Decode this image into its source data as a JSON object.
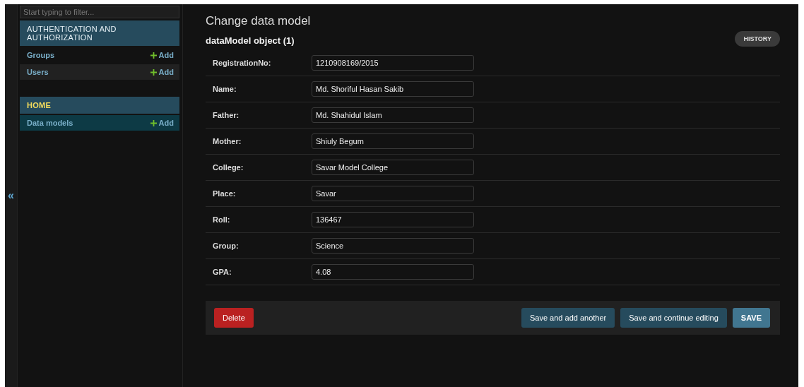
{
  "toggle_nav": {
    "label": "«"
  },
  "sidebar": {
    "filter": {
      "placeholder": "Start typing to filter..."
    },
    "modules": [
      {
        "title": "AUTHENTICATION AND AUTHORIZATION",
        "items": [
          {
            "label": "Groups",
            "add": "Add",
            "selected": false
          },
          {
            "label": "Users",
            "add": "Add",
            "selected": false
          }
        ]
      },
      {
        "title": "HOME",
        "items": [
          {
            "label": "Data models",
            "add": "Add",
            "selected": true
          }
        ]
      }
    ]
  },
  "page": {
    "title": "Change data model",
    "object_title": "dataModel object (1)",
    "history": "HISTORY",
    "fields": [
      {
        "label": "RegistrationNo:",
        "value": "1210908169/2015"
      },
      {
        "label": "Name:",
        "value": "Md. Shoriful Hasan Sakib"
      },
      {
        "label": "Father:",
        "value": "Md. Shahidul Islam"
      },
      {
        "label": "Mother:",
        "value": "Shiuly Begum"
      },
      {
        "label": "College:",
        "value": "Savar Model College"
      },
      {
        "label": "Place:",
        "value": "Savar"
      },
      {
        "label": "Roll:",
        "value": "136467"
      },
      {
        "label": "Group:",
        "value": "Science"
      },
      {
        "label": "GPA:",
        "value": "4.08"
      }
    ],
    "actions": {
      "delete": "Delete",
      "buttons": [
        {
          "label": "Save and add another",
          "kind": "secondary"
        },
        {
          "label": "Save and continue editing",
          "kind": "secondary"
        },
        {
          "label": "SAVE",
          "kind": "primary"
        }
      ]
    }
  }
}
